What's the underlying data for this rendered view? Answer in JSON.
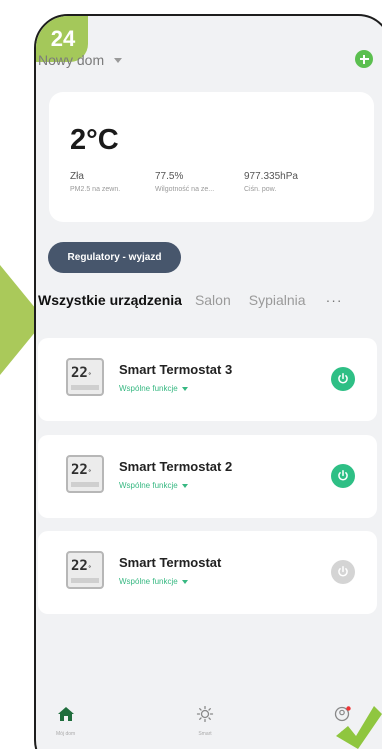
{
  "step_badge": "24",
  "header": {
    "home_name": "Nowy dom"
  },
  "weather": {
    "temperature": "2°C",
    "metrics": [
      {
        "value": "Zła",
        "label": "PM2.5 na zewn."
      },
      {
        "value": "77.5%",
        "label": "Wilgotność na ze..."
      },
      {
        "value": "977.335hPa",
        "label": "Ciśn. pow."
      }
    ]
  },
  "scene_button": "Regulatory - wyjazd",
  "room_tabs": {
    "active": "Wszystkie urządzenia",
    "salon": "Salon",
    "sypialnia": "Sypialnia",
    "more": "···"
  },
  "devices": [
    {
      "name": "Smart Termostat 3",
      "subtitle": "Wspólne funkcje",
      "lcd": "22",
      "power": "on"
    },
    {
      "name": "Smart Termostat 2",
      "subtitle": "Wspólne funkcje",
      "lcd": "22",
      "power": "on"
    },
    {
      "name": "Smart Termostat",
      "subtitle": "Wspólne funkcje",
      "lcd": "22",
      "power": "off"
    }
  ],
  "nav": {
    "home": "Mój dom",
    "smart": "Smart",
    "me": "Ja"
  },
  "colors": {
    "accent_green": "#2ebf85",
    "badge_green": "#a4c85a",
    "scene_button": "#47566c",
    "power_off": "#d4d4d4"
  }
}
